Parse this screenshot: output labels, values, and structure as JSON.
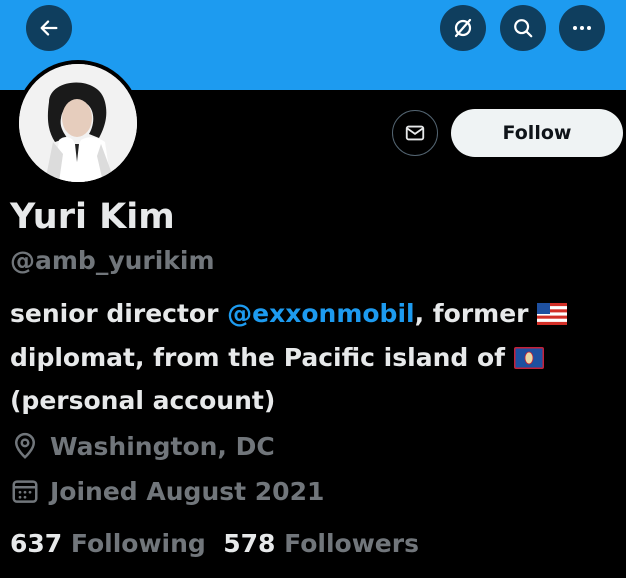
{
  "profile": {
    "name": "Yuri Kim",
    "handle": "@amb_yurikim",
    "follow_label": "Follow"
  },
  "bio": {
    "line1_pre": "senior director ",
    "mention": "@exxonmobil",
    "line1_post": ", former",
    "line2": "diplomat, from the Pacific island of",
    "line3": "(personal account)"
  },
  "meta": {
    "location": "Washington, DC",
    "joined": "Joined August 2021"
  },
  "stats": {
    "following_count": "637",
    "following_label": "Following",
    "followers_count": "578",
    "followers_label": "Followers"
  },
  "icons": {
    "back": "arrow-left-icon",
    "grok": "slash-circle-icon",
    "search": "search-icon",
    "more": "more-icon",
    "message": "envelope-icon",
    "location": "location-pin-icon",
    "calendar": "calendar-icon",
    "flag_us": "us-flag-icon",
    "flag_guam": "guam-flag-icon"
  },
  "colors": {
    "banner": "#1d9bf0",
    "background": "#000000",
    "accent": "#1d9bf0",
    "text_primary": "#e7e9ea",
    "text_secondary": "#71767b"
  }
}
